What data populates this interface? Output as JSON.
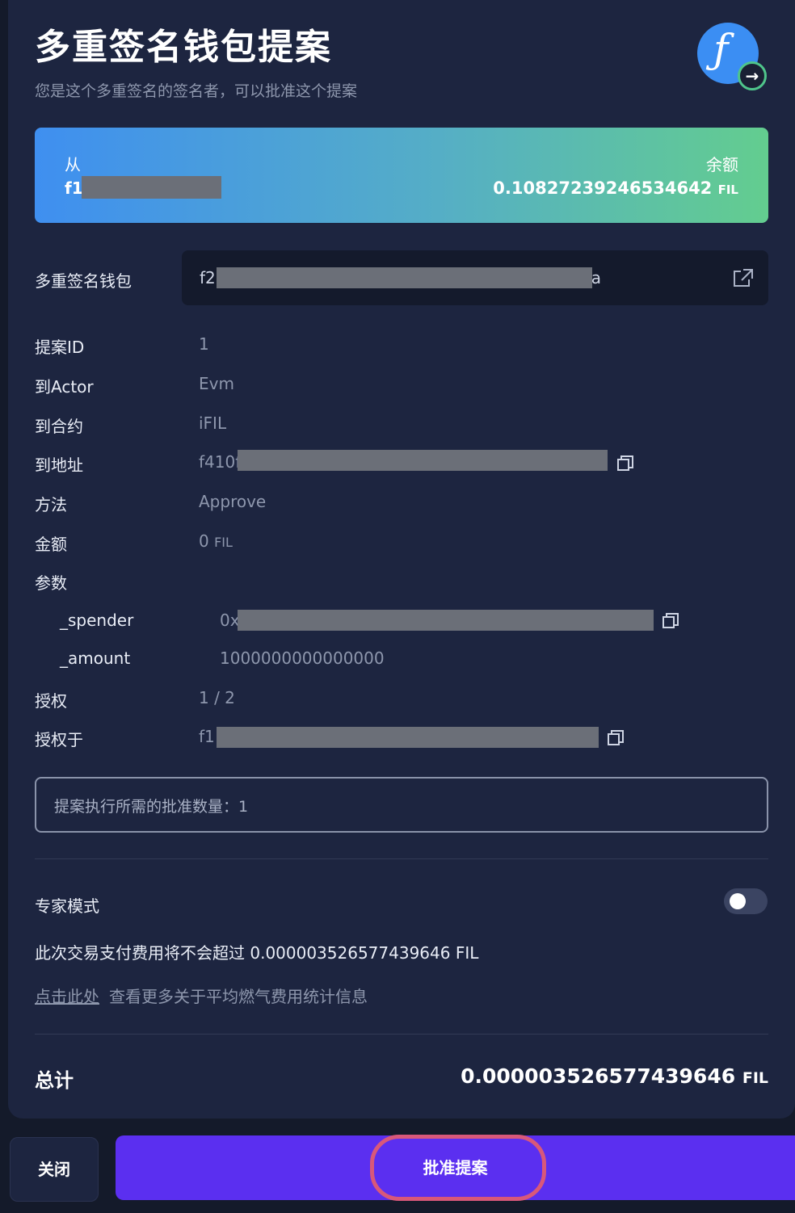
{
  "header": {
    "title": "多重签名钱包提案",
    "subtitle": "您是这个多重签名的签名者，可以批准这个提案"
  },
  "balance_card": {
    "from_label": "从",
    "from_value": "f1",
    "balance_label": "余额",
    "balance_value": "0.10827239246534642",
    "balance_unit": "FIL"
  },
  "wallet": {
    "label": "多重签名钱包",
    "value_prefix": "f2",
    "value_suffix": "a"
  },
  "details": {
    "proposal_id_label": "提案ID",
    "proposal_id": "1",
    "to_actor_label": "到Actor",
    "to_actor": "Evm",
    "to_contract_label": "到合约",
    "to_contract": "iFIL",
    "to_address_label": "到地址",
    "to_address": "f410f",
    "method_label": "方法",
    "method": "Approve",
    "amount_label": "金额",
    "amount": "0",
    "amount_unit": "FIL",
    "params_label": "参数",
    "spender_label": "_spender",
    "spender_value": "0x",
    "amount_param_label": "_amount",
    "amount_param_value": "1000000000000000",
    "auth_label": "授权",
    "auth_value": "1 / 2",
    "auth_by_label": "授权于",
    "auth_by_value": "f1"
  },
  "approval_note": "提案执行所需的批准数量：1",
  "expert": {
    "label": "专家模式",
    "enabled": false
  },
  "fee": {
    "text": "此次交易支付费用将不会超过 0.000003526577439646 FIL",
    "link": "点击此处",
    "link_suffix": "查看更多关于平均燃气费用统计信息"
  },
  "total": {
    "label": "总计",
    "value": "0.000003526577439646",
    "unit": "FIL"
  },
  "buttons": {
    "close": "关闭",
    "approve": "批准提案"
  },
  "colors": {
    "primary": "#5b2ff0",
    "panel": "#1d2540",
    "highlight_ring": "#d8587a",
    "gradient_start": "#3f8ff0",
    "gradient_end": "#63cd8f"
  }
}
